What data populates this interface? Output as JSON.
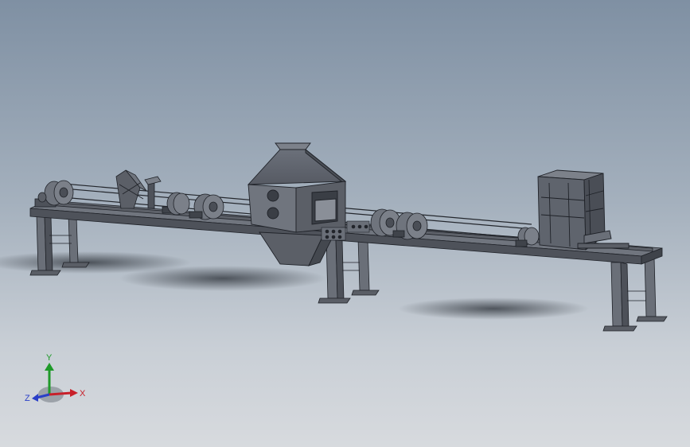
{
  "viewport": {
    "background_top": "#7f90a3",
    "background_bottom": "#d7dade"
  },
  "model": {
    "part_color": "#5f646d",
    "edge_color": "#1f2228"
  },
  "triad": {
    "x_label": "X",
    "y_label": "Y",
    "z_label": "Z",
    "x_color": "#c8202a",
    "y_color": "#1f9a2a",
    "z_color": "#2a3fc8"
  }
}
